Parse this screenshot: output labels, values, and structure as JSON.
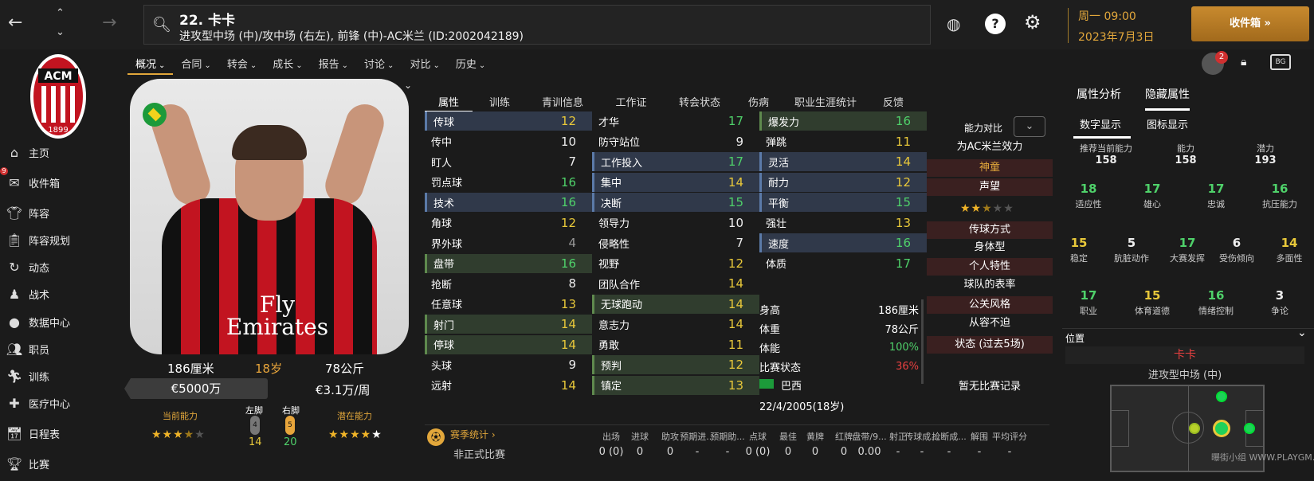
{
  "header": {
    "title": "22. 卡卡",
    "subtitle": "进攻型中场 (中)/攻中场 (右左), 前锋 (中)-AC米兰 (ID:2002042189)",
    "date1": "周一 09:00",
    "date2": "2023年7月3日",
    "inbox_button": "收件箱 »",
    "inbox_badge": "2"
  },
  "sidebar": {
    "badge": "9",
    "items": [
      "主页",
      "收件箱",
      "阵容",
      "阵容规划",
      "动态",
      "战术",
      "数据中心",
      "职员",
      "训练",
      "医疗中心",
      "日程表",
      "比赛"
    ]
  },
  "menu": [
    "概况",
    "合同",
    "转会",
    "成长",
    "报告",
    "讨论",
    "对比",
    "历史"
  ],
  "player": {
    "height": "186厘米",
    "age": "18岁",
    "weight": "78公斤",
    "value": "€5000万",
    "wage": "€3.1万/周",
    "ca_label": "当前能力",
    "pa_label": "潜在能力",
    "left_foot_label": "左脚",
    "right_foot_label": "右脚",
    "left_foot": "14",
    "right_foot": "20",
    "left_foot_badge": "4",
    "right_foot_badge": "5",
    "sponsor": "Fly Emirates",
    "ca_stars": 3.5,
    "pa_stars": 5
  },
  "tabs": [
    "属性",
    "训练",
    "青训信息",
    "工作证",
    "转会状态",
    "伤病",
    "职业生涯统计",
    "反馈"
  ],
  "technical": [
    [
      "传球",
      "12"
    ],
    [
      "传中",
      "10"
    ],
    [
      "盯人",
      "7"
    ],
    [
      "罚点球",
      "16"
    ],
    [
      "技术",
      "16"
    ],
    [
      "角球",
      "12"
    ],
    [
      "界外球",
      "4"
    ],
    [
      "盘带",
      "16"
    ],
    [
      "抢断",
      "8"
    ],
    [
      "任意球",
      "13"
    ],
    [
      "射门",
      "14"
    ],
    [
      "停球",
      "14"
    ],
    [
      "头球",
      "9"
    ],
    [
      "远射",
      "14"
    ]
  ],
  "mental": [
    [
      "才华",
      "17"
    ],
    [
      "防守站位",
      "9"
    ],
    [
      "工作投入",
      "17"
    ],
    [
      "集中",
      "14"
    ],
    [
      "决断",
      "15"
    ],
    [
      "领导力",
      "10"
    ],
    [
      "侵略性",
      "7"
    ],
    [
      "视野",
      "12"
    ],
    [
      "团队合作",
      "14"
    ],
    [
      "无球跑动",
      "14"
    ],
    [
      "意志力",
      "14"
    ],
    [
      "勇敢",
      "11"
    ],
    [
      "预判",
      "12"
    ],
    [
      "镇定",
      "13"
    ]
  ],
  "physical": [
    [
      "爆发力",
      "16"
    ],
    [
      "弹跳",
      "11"
    ],
    [
      "灵活",
      "14"
    ],
    [
      "耐力",
      "12"
    ],
    [
      "平衡",
      "15"
    ],
    [
      "强壮",
      "13"
    ],
    [
      "速度",
      "16"
    ],
    [
      "体质",
      "17"
    ]
  ],
  "info": [
    [
      "身高",
      "186厘米"
    ],
    [
      "体重",
      "78公斤"
    ],
    [
      "体能",
      "100%"
    ],
    [
      "比赛状态",
      "36%"
    ]
  ],
  "nationality": "巴西",
  "dob": "22/4/2005(18岁)",
  "middle": {
    "compare_label": "能力对比",
    "play_for": "为AC米兰效力",
    "status": "神童",
    "reputation": "声望",
    "pass_style": "传球方式",
    "body_type": "身体型",
    "traits": "个人特性",
    "team_perf": "球队的表率",
    "pr_style": "公关风格",
    "pr_value": "从容不迫",
    "form_label": "状态 (过去5场)",
    "no_record": "暂无比赛记录",
    "rep_stars": 2.5
  },
  "season": {
    "title": "赛季统计 ›",
    "competition": "非正式比赛",
    "cols": [
      "出场",
      "进球",
      "助攻",
      "预期进...",
      "预期助...",
      "点球",
      "最佳",
      "黄牌",
      "红牌",
      "盘带/9...",
      "射正",
      "传球成...",
      "抢断成...",
      "解围",
      "平均评分"
    ],
    "vals": [
      "0 (0)",
      "0",
      "0",
      "-",
      "-",
      "0 (0)",
      "0",
      "0",
      "0",
      "0.00",
      "-",
      "-",
      "-",
      "-",
      "-"
    ]
  },
  "right": {
    "tab1": "属性分析",
    "tab2": "隐藏属性",
    "sub1": "数字显示",
    "sub2": "图标显示",
    "top": [
      [
        "推荐当前能力",
        "158"
      ],
      [
        "能力",
        "158"
      ],
      [
        "潜力",
        "193"
      ]
    ],
    "row1": [
      [
        "18",
        "适应性"
      ],
      [
        "17",
        "雄心"
      ],
      [
        "17",
        "忠诚"
      ],
      [
        "16",
        "抗压能力"
      ]
    ],
    "row2": [
      [
        "15",
        "稳定"
      ],
      [
        "5",
        "肮脏动作"
      ],
      [
        "17",
        "大赛发挥"
      ],
      [
        "6",
        "受伤倾向"
      ],
      [
        "14",
        "多面性"
      ]
    ],
    "row3": [
      [
        "17",
        "职业"
      ],
      [
        "15",
        "体育道德"
      ],
      [
        "16",
        "情绪控制"
      ],
      [
        "3",
        "争论"
      ]
    ],
    "position_label": "位置",
    "pos_name": "卡卡",
    "pos_role": "进攻型中场 (中)",
    "watermark": "曝街小组 WWW.PLAYGM.CC"
  },
  "colors": {
    "accent": "#e2a73b",
    "green": "#4fd16a",
    "yellow": "#e8c83a",
    "red": "#e84040"
  }
}
